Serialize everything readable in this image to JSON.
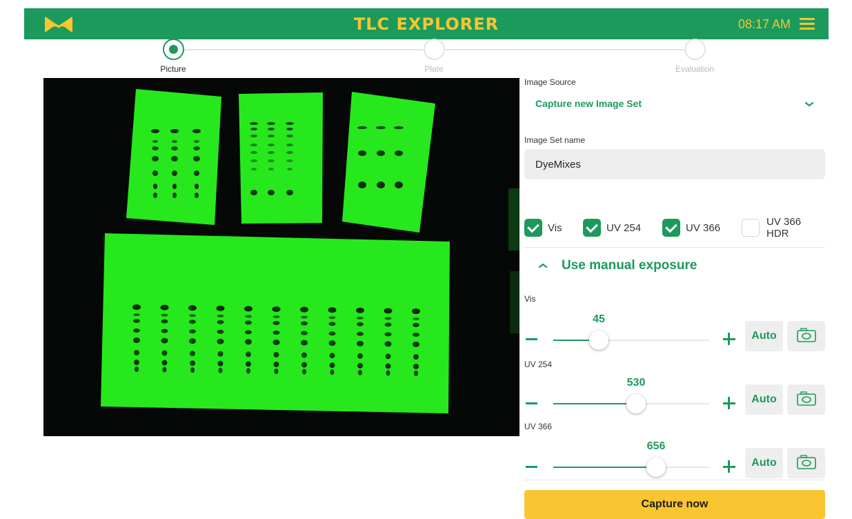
{
  "header": {
    "app_title": "TLC EXPLORER",
    "time": "08:17 AM",
    "logo_icon": "m-logo-icon",
    "menu_icon": "hamburger-menu-icon",
    "brand_color": "#1b9a5c",
    "accent_color": "#f9c531"
  },
  "stepper": {
    "steps": [
      {
        "label": "Picture",
        "state": "active"
      },
      {
        "label": "Plate",
        "state": "inactive"
      },
      {
        "label": "Evaluation",
        "state": "inactive"
      }
    ]
  },
  "form": {
    "image_source_label": "Image Source",
    "image_source_value": "Capture new Image Set",
    "image_set_name_label": "Image Set name",
    "image_set_name_value": "DyeMixes",
    "checkboxes": [
      {
        "label": "Vis",
        "checked": true
      },
      {
        "label": "UV 254",
        "checked": true
      },
      {
        "label": "UV 366",
        "checked": true
      },
      {
        "label": "UV 366 HDR",
        "checked": false
      }
    ],
    "manual_exposure_label": "Use manual exposure"
  },
  "exposure": {
    "sliders": [
      {
        "label": "Vis",
        "value": "45",
        "fraction": 0.29,
        "auto_label": "Auto"
      },
      {
        "label": "UV 254",
        "value": "530",
        "fraction": 0.53,
        "auto_label": "Auto"
      },
      {
        "label": "UV 366",
        "value": "656",
        "fraction": 0.66,
        "auto_label": "Auto"
      }
    ]
  },
  "capture_label": "Capture now"
}
